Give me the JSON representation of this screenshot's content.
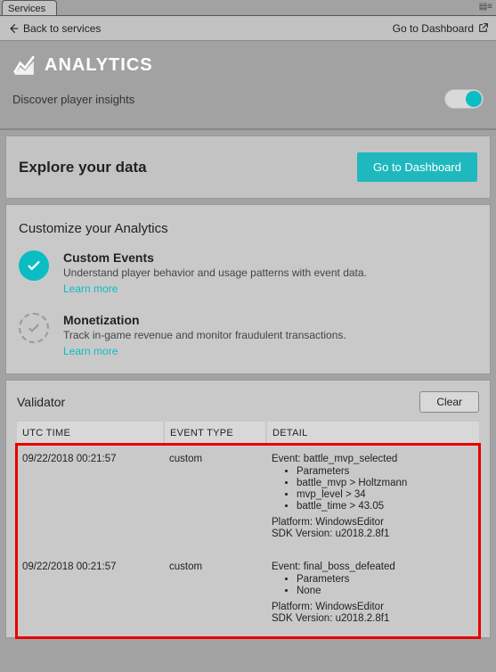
{
  "tab": {
    "label": "Services"
  },
  "breadcrumb": {
    "back_label": "Back to services",
    "dashboard_label": "Go to Dashboard"
  },
  "header": {
    "title": "ANALYTICS",
    "subtitle": "Discover player insights",
    "toggle_on": true
  },
  "explore": {
    "title": "Explore your data",
    "button": "Go to Dashboard"
  },
  "customize": {
    "title": "Customize your Analytics",
    "features": [
      {
        "name": "Custom Events",
        "desc": "Understand player behavior and usage patterns with event data.",
        "learn": "Learn more",
        "enabled": true
      },
      {
        "name": "Monetization",
        "desc": "Track in-game revenue and monitor fraudulent transactions.",
        "learn": "Learn more",
        "enabled": false
      }
    ]
  },
  "validator": {
    "title": "Validator",
    "clear_label": "Clear",
    "columns": {
      "time": "UTC TIME",
      "type": "EVENT TYPE",
      "detail": "DETAIL"
    },
    "rows": [
      {
        "time": "09/22/2018 00:21:57",
        "type": "custom",
        "event": "battle_mvp_selected",
        "params": [
          "Parameters",
          "battle_mvp > Holtzmann",
          "mvp_level > 34",
          "battle_time > 43.05"
        ],
        "platform": "WindowsEditor",
        "sdk": "u2018.2.8f1"
      },
      {
        "time": "09/22/2018 00:21:57",
        "type": "custom",
        "event": "final_boss_defeated",
        "params": [
          "Parameters",
          "None"
        ],
        "platform": "WindowsEditor",
        "sdk": "u2018.2.8f1"
      }
    ]
  },
  "labels": {
    "event_prefix": "Event: ",
    "platform_prefix": "Platform: ",
    "sdk_prefix": "SDK Version: "
  }
}
